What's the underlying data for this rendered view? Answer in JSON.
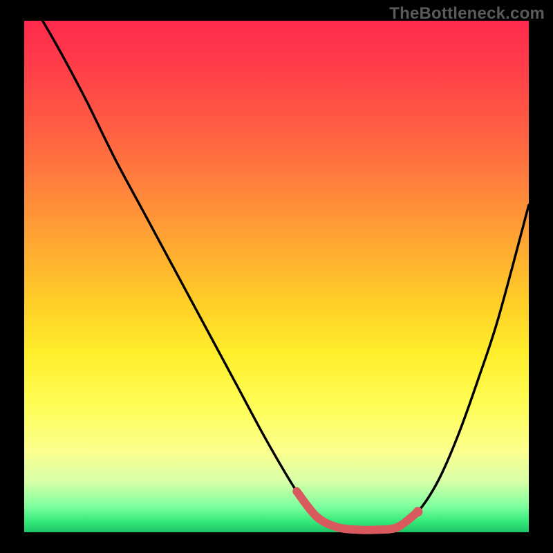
{
  "watermark": "TheBottleneck.com",
  "colors": {
    "background": "#000000",
    "curve": "#000000",
    "highlight": "#d85a5f",
    "gradient_stops": [
      "#ff2a4d",
      "#ff3b4a",
      "#ff5544",
      "#ff7a3e",
      "#ffa233",
      "#ffce28",
      "#ffee2a",
      "#fffd55",
      "#fcff8d",
      "#d8ffa8",
      "#7dff9e",
      "#32e877",
      "#1fc468"
    ]
  },
  "chart_data": {
    "type": "line",
    "title": "",
    "xlabel": "",
    "ylabel": "",
    "xlim": [
      0,
      100
    ],
    "ylim": [
      0,
      100
    ],
    "grid": false,
    "legend": false,
    "x": [
      0,
      6,
      12,
      18,
      24,
      30,
      36,
      42,
      48,
      54,
      58,
      62,
      66,
      70,
      74,
      78,
      82,
      86,
      90,
      94,
      100
    ],
    "series": [
      {
        "name": "bottleneck-curve",
        "values": [
          106,
          96,
          85,
          73,
          62,
          51,
          40,
          29,
          18,
          8,
          3,
          1,
          0.5,
          0.5,
          1,
          4,
          10,
          19,
          30,
          42,
          64
        ]
      }
    ],
    "highlight_segment": {
      "x_from": 56,
      "x_to": 76
    }
  }
}
